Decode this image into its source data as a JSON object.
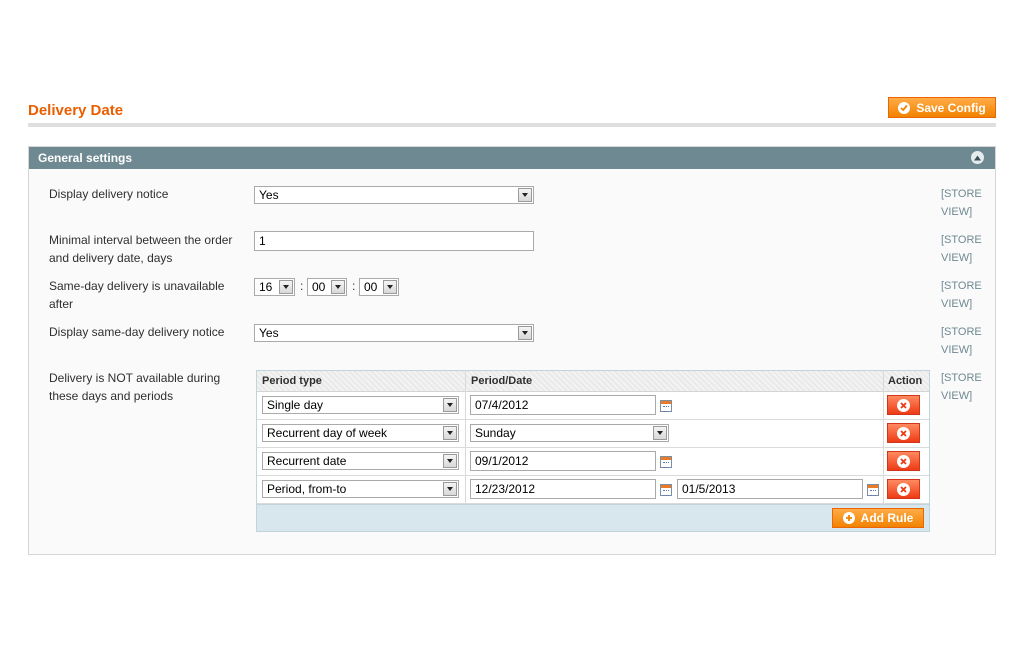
{
  "page": {
    "title": "Delivery Date",
    "save_label": "Save Config"
  },
  "section": {
    "title": "General settings",
    "scope_line1": "[STORE",
    "scope_line2": "VIEW]",
    "fields": {
      "display_notice": {
        "label": "Display delivery notice",
        "value": "Yes"
      },
      "min_interval": {
        "label": "Minimal interval between the order and delivery date, days",
        "value": "1"
      },
      "same_day_cutoff": {
        "label": "Same-day delivery is unavailable after",
        "hour": "16",
        "minute": "00",
        "second": "00",
        "separator": ":"
      },
      "same_day_notice": {
        "label": "Display same-day delivery notice",
        "value": "Yes"
      },
      "unavailable_periods": {
        "label": "Delivery is NOT available during these days and periods"
      }
    }
  },
  "rules_table": {
    "headers": {
      "period_type": "Period type",
      "period_date": "Period/Date",
      "action": "Action"
    },
    "rows": [
      {
        "type": "Single day",
        "date": "07/4/2012"
      },
      {
        "type": "Recurrent day of week",
        "day": "Sunday"
      },
      {
        "type": "Recurrent date",
        "date": "09/1/2012"
      },
      {
        "type": "Period, from-to",
        "from": "12/23/2012",
        "to": "01/5/2013"
      }
    ],
    "add_label": "Add Rule"
  },
  "colors": {
    "accent": "#eb5e00",
    "button": "#f18200",
    "section_header": "#6f8992",
    "delete": "#ee3b16"
  },
  "icons": [
    "check-icon",
    "collapse-arrow-icon",
    "calendar-icon",
    "delete-icon",
    "plus-icon",
    "dropdown-arrow-icon"
  ]
}
